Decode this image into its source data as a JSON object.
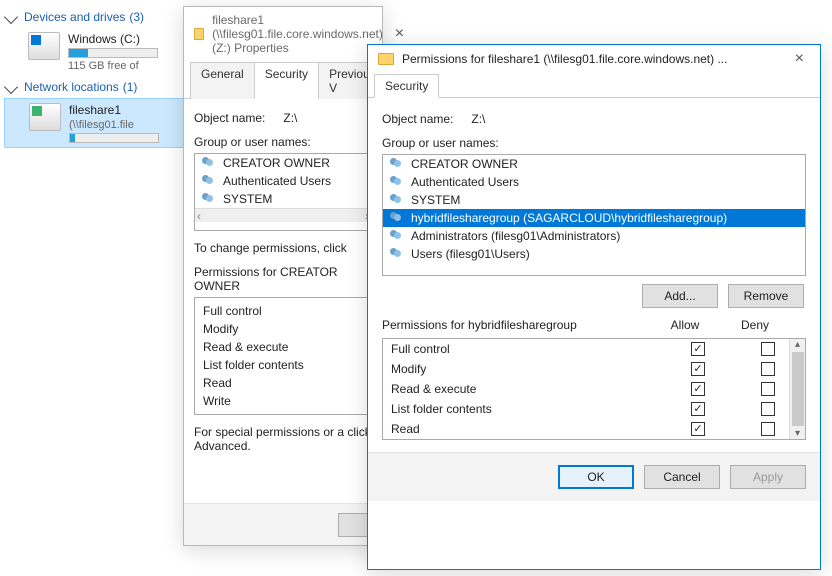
{
  "explorer": {
    "devices_header": "Devices and drives",
    "devices_count": "(3)",
    "network_header": "Network locations",
    "network_count": "(1)",
    "drive_c": {
      "label": "Windows (C:)",
      "sub": "115 GB free of",
      "fill_pct": 22
    },
    "fileshare": {
      "label": "fileshare1",
      "sub": "(\\\\filesg01.file",
      "fill_pct": 6
    }
  },
  "props": {
    "title": "fileshare1 (\\\\filesg01.file.core.windows.net) (Z:) Properties",
    "tabs": {
      "general": "General",
      "security": "Security",
      "previous": "Previous V"
    },
    "object_label": "Object name:",
    "object_value": "Z:\\",
    "group_label": "Group or user names:",
    "groups": [
      "CREATOR OWNER",
      "Authenticated Users",
      "SYSTEM"
    ],
    "change_hint": "To change permissions, click",
    "perm_for_label": "Permissions for CREATOR OWNER",
    "perms": [
      "Full control",
      "Modify",
      "Read & execute",
      "List folder contents",
      "Read",
      "Write"
    ],
    "special_hint": "For special permissions or a click Advanced."
  },
  "perm": {
    "title": "Permissions for fileshare1 (\\\\filesg01.file.core.windows.net) ...",
    "tab_security": "Security",
    "object_label": "Object name:",
    "object_value": "Z:\\",
    "group_label": "Group or user names:",
    "groups": [
      "CREATOR OWNER",
      "Authenticated Users",
      "SYSTEM",
      "hybridfilesharegroup (SAGARCLOUD\\hybridfilesharegroup)",
      "Administrators (filesg01\\Administrators)",
      "Users (filesg01\\Users)"
    ],
    "selected_index": 3,
    "add_btn": "Add...",
    "remove_btn": "Remove",
    "perm_for_label": "Permissions for hybridfilesharegroup",
    "col_allow": "Allow",
    "col_deny": "Deny",
    "rows": [
      {
        "name": "Full control",
        "allow": true,
        "deny": false
      },
      {
        "name": "Modify",
        "allow": true,
        "deny": false
      },
      {
        "name": "Read & execute",
        "allow": true,
        "deny": false
      },
      {
        "name": "List folder contents",
        "allow": true,
        "deny": false
      },
      {
        "name": "Read",
        "allow": true,
        "deny": false
      }
    ],
    "ok": "OK",
    "cancel": "Cancel",
    "apply": "Apply"
  }
}
